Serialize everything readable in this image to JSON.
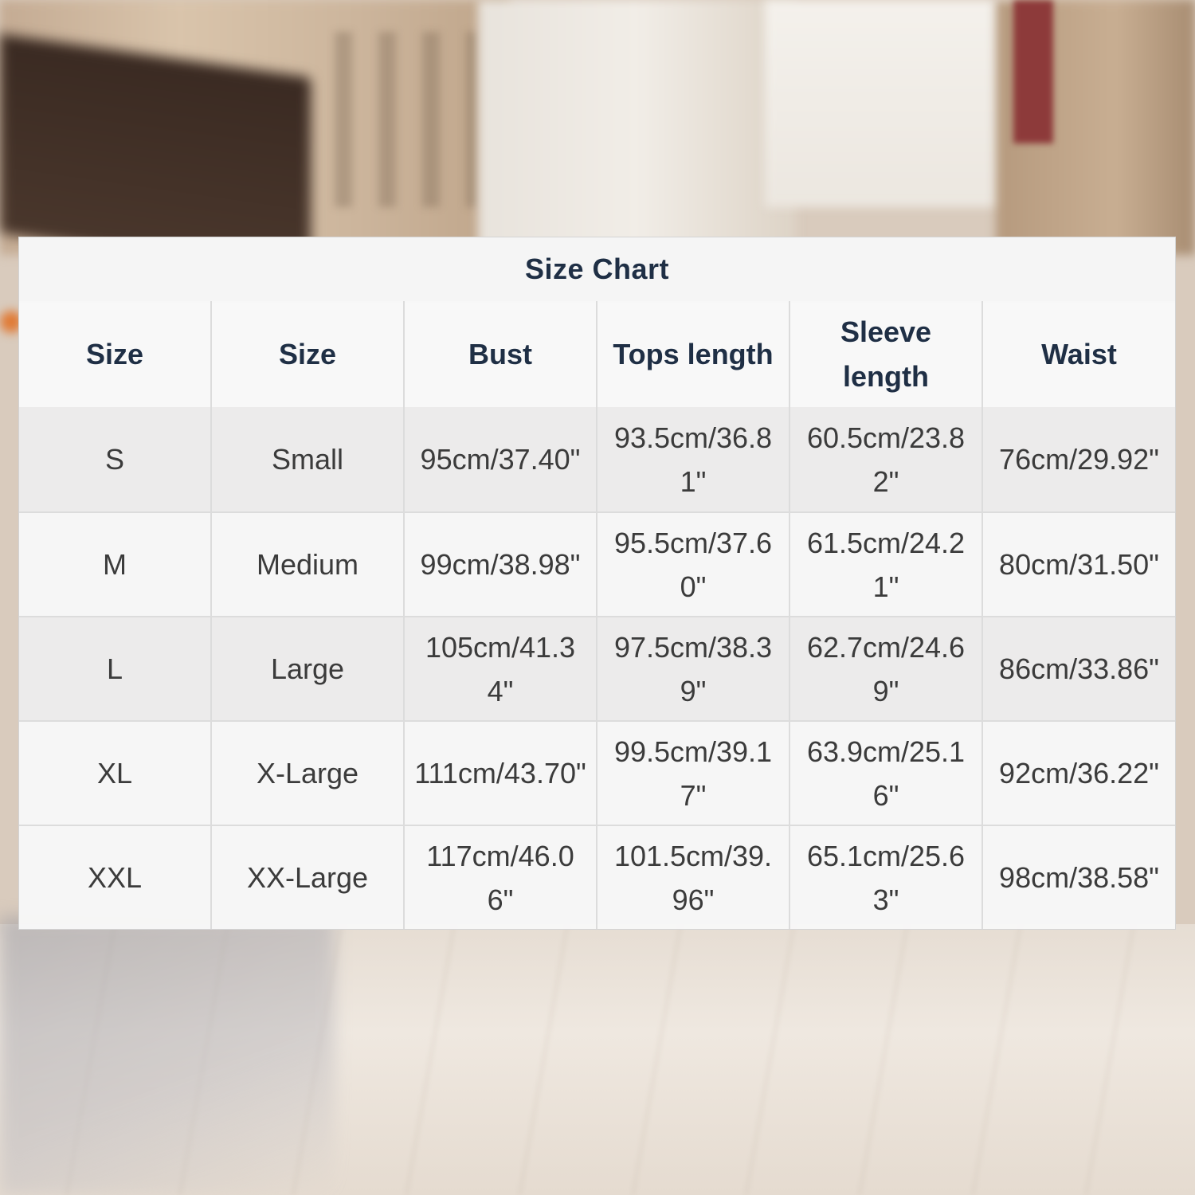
{
  "chart": {
    "title": "Size Chart",
    "headers": [
      "Size",
      "Size",
      "Bust",
      "Tops length",
      "Sleeve length",
      "Waist"
    ],
    "rows": [
      [
        "S",
        "Small",
        "95cm/37.40\"",
        "93.5cm/36.81\"",
        "60.5cm/23.82\"",
        "76cm/29.92\""
      ],
      [
        "M",
        "Medium",
        "99cm/38.98\"",
        "95.5cm/37.60\"",
        "61.5cm/24.21\"",
        "80cm/31.50\""
      ],
      [
        "L",
        "Large",
        "105cm/41.34\"",
        "97.5cm/38.39\"",
        "62.7cm/24.69\"",
        "86cm/33.86\""
      ],
      [
        "XL",
        "X-Large",
        "111cm/43.70\"",
        "99.5cm/39.17\"",
        "63.9cm/25.16\"",
        "92cm/36.22\""
      ],
      [
        "XXL",
        "XX-Large",
        "117cm/46.06\"",
        "101.5cm/39.96\"",
        "65.1cm/25.63\"",
        "98cm/38.58\""
      ]
    ]
  },
  "colors": {
    "heading_text": "#1f2f45",
    "body_text": "#3b3b3b",
    "grid_line": "#dcdcdc"
  }
}
